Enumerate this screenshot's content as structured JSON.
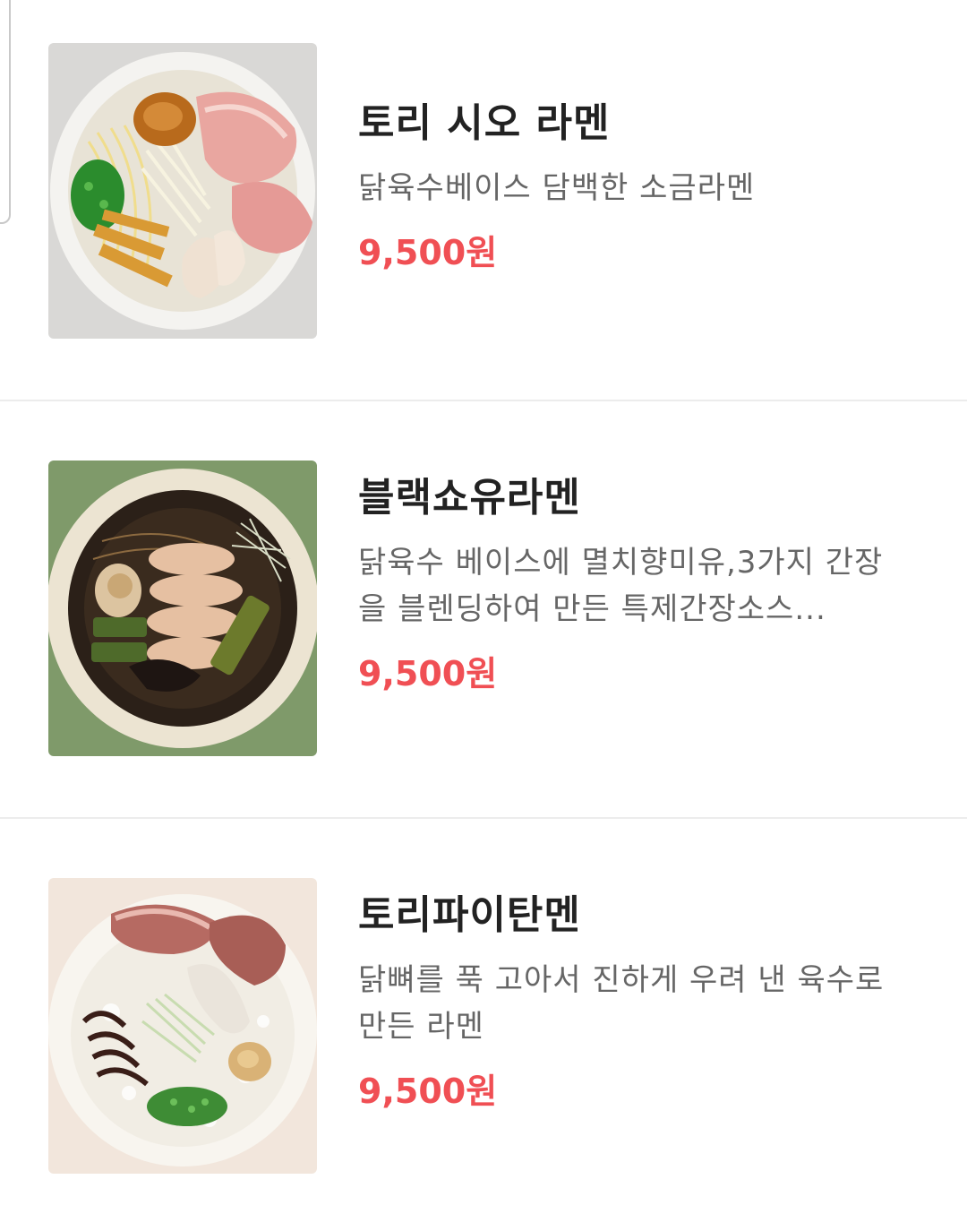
{
  "menu": {
    "items": [
      {
        "name": "토리 시오 라멘",
        "description": "닭육수베이스 담백한 소금라멘",
        "price": "9,500원",
        "image_icon": "shio-ramen-photo"
      },
      {
        "name": "블랙쇼유라멘",
        "description": "닭육수 베이스에 멸치향미유,3가지 간장을 블렌딩하여 만든 특제간장소스...",
        "price": "9,500원",
        "image_icon": "black-shoyu-ramen-photo"
      },
      {
        "name": "토리파이탄멘",
        "description": "닭뼈를 푹 고아서 진하게 우려 낸 육수로 만든 라멘",
        "price": "9,500원",
        "image_icon": "paitan-ramen-photo"
      }
    ],
    "colors": {
      "price": "#f04f54",
      "name": "#222222",
      "description": "#666666",
      "divider": "#ececec"
    }
  }
}
